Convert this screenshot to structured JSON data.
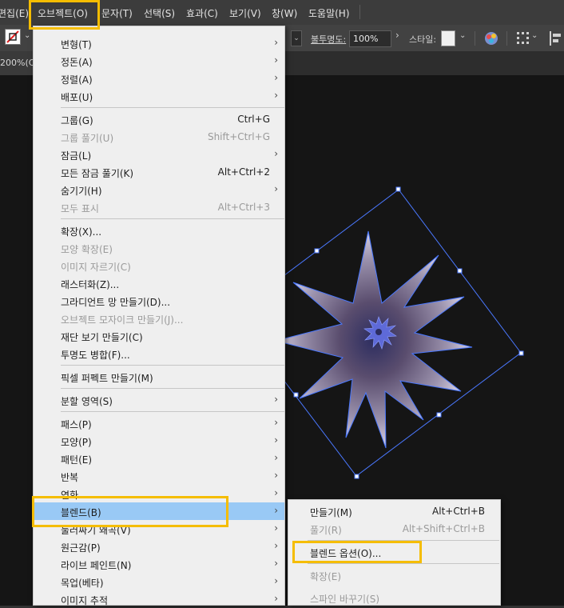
{
  "menubar": {
    "items": [
      "편집(E)",
      "오브젝트(O)",
      "문자(T)",
      "선택(S)",
      "효과(C)",
      "보기(V)",
      "창(W)",
      "도움말(H)"
    ]
  },
  "controlbar": {
    "opacity_label": "불투명도:",
    "opacity_value": "100%",
    "style_label": "스타일:"
  },
  "tab": {
    "zoom_text": "200%(C"
  },
  "object_menu": {
    "items": [
      {
        "label": "변형(T)",
        "submenu": true
      },
      {
        "label": "정돈(A)",
        "submenu": true
      },
      {
        "label": "정렬(A)",
        "submenu": true
      },
      {
        "label": "배포(U)",
        "submenu": true
      },
      {
        "label": "그룹(G)",
        "shortcut": "Ctrl+G"
      },
      {
        "label": "그룹 풀기(U)",
        "shortcut": "Shift+Ctrl+G",
        "disabled": true
      },
      {
        "label": "잠금(L)",
        "submenu": true
      },
      {
        "label": "모든 잠금 풀기(K)",
        "shortcut": "Alt+Ctrl+2"
      },
      {
        "label": "숨기기(H)",
        "submenu": true
      },
      {
        "label": "모두 표시",
        "shortcut": "Alt+Ctrl+3",
        "disabled": true
      },
      {
        "label": "확장(X)..."
      },
      {
        "label": "모양 확장(E)",
        "disabled": true
      },
      {
        "label": "이미지 자르기(C)",
        "disabled": true
      },
      {
        "label": "래스터화(Z)..."
      },
      {
        "label": "그라디언트 망 만들기(D)..."
      },
      {
        "label": "오브젝트 모자이크 만들기(J)...",
        "disabled": true
      },
      {
        "label": "재단 보기 만들기(C)"
      },
      {
        "label": "투명도 병합(F)..."
      },
      {
        "label": "픽셀 퍼펙트 만들기(M)"
      },
      {
        "label": "분할 영역(S)",
        "submenu": true
      },
      {
        "label": "패스(P)",
        "submenu": true
      },
      {
        "label": "모양(P)",
        "submenu": true
      },
      {
        "label": "패턴(E)",
        "submenu": true
      },
      {
        "label": "반복",
        "submenu": true
      },
      {
        "label": "연화",
        "submenu": true
      },
      {
        "label": "블렌드(B)",
        "submenu": true,
        "active": true
      },
      {
        "label": "둘러싸기 왜곡(V)",
        "submenu": true
      },
      {
        "label": "원근감(P)",
        "submenu": true
      },
      {
        "label": "라이브 페인트(N)",
        "submenu": true
      },
      {
        "label": "목업(베타)",
        "submenu": true
      },
      {
        "label": "이미지 추적",
        "submenu": true
      }
    ]
  },
  "blend_submenu": {
    "items": [
      {
        "label": "만들기(M)",
        "shortcut": "Alt+Ctrl+B"
      },
      {
        "label": "풀기(R)",
        "shortcut": "Alt+Shift+Ctrl+B",
        "disabled": true
      },
      {
        "label": "블렌드 옵션(O)..."
      },
      {
        "label": "확장(E)",
        "disabled": true
      },
      {
        "label": "스파인 바꾸기(S)",
        "disabled": true
      }
    ]
  },
  "colors": {
    "highlight_box": "#f5bd00",
    "selection_bounds": "#4a78ff",
    "active_item": "#99c9f5"
  }
}
